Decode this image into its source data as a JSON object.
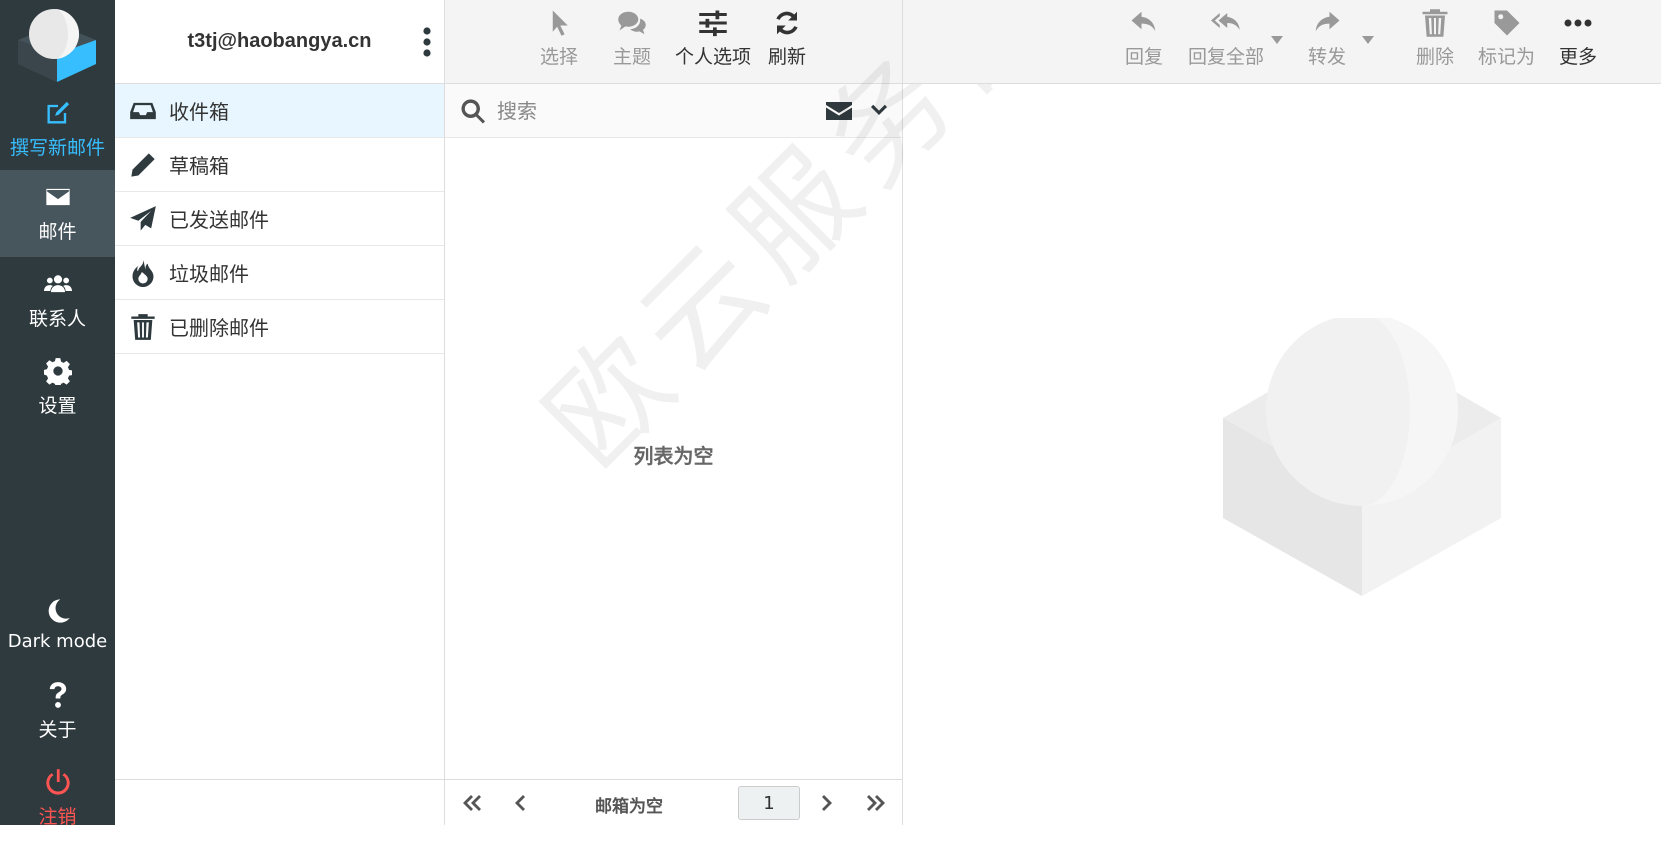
{
  "account": {
    "email": "t3tj@haobangya.cn"
  },
  "taskbar": {
    "compose": "撰写新邮件",
    "mail": "邮件",
    "contacts": "联系人",
    "settings": "设置",
    "dark_mode": "Dark mode",
    "about": "关于",
    "logout": "注销"
  },
  "folders": [
    {
      "label": "收件箱",
      "icon": "inbox-icon"
    },
    {
      "label": "草稿箱",
      "icon": "pencil-icon"
    },
    {
      "label": "已发送邮件",
      "icon": "paper-plane-icon"
    },
    {
      "label": "垃圾邮件",
      "icon": "fire-icon"
    },
    {
      "label": "已删除邮件",
      "icon": "trash-icon"
    }
  ],
  "list_toolbar": {
    "select": "选择",
    "threads": "主题",
    "options": "个人选项",
    "refresh": "刷新"
  },
  "search": {
    "placeholder": "搜索"
  },
  "list": {
    "empty": "列表为空"
  },
  "watermark": "欧云服务器",
  "pagination": {
    "status": "邮箱为空",
    "page": "1"
  },
  "preview_toolbar": {
    "reply": "回复",
    "reply_all": "回复全部",
    "forward": "转发",
    "delete": "删除",
    "mark": "标记为",
    "more": "更多"
  },
  "colors": {
    "sidebar": "#2f3a3f",
    "accent": "#37beff",
    "logout": "#ff5552",
    "active_folder": "#e8f7ff"
  }
}
